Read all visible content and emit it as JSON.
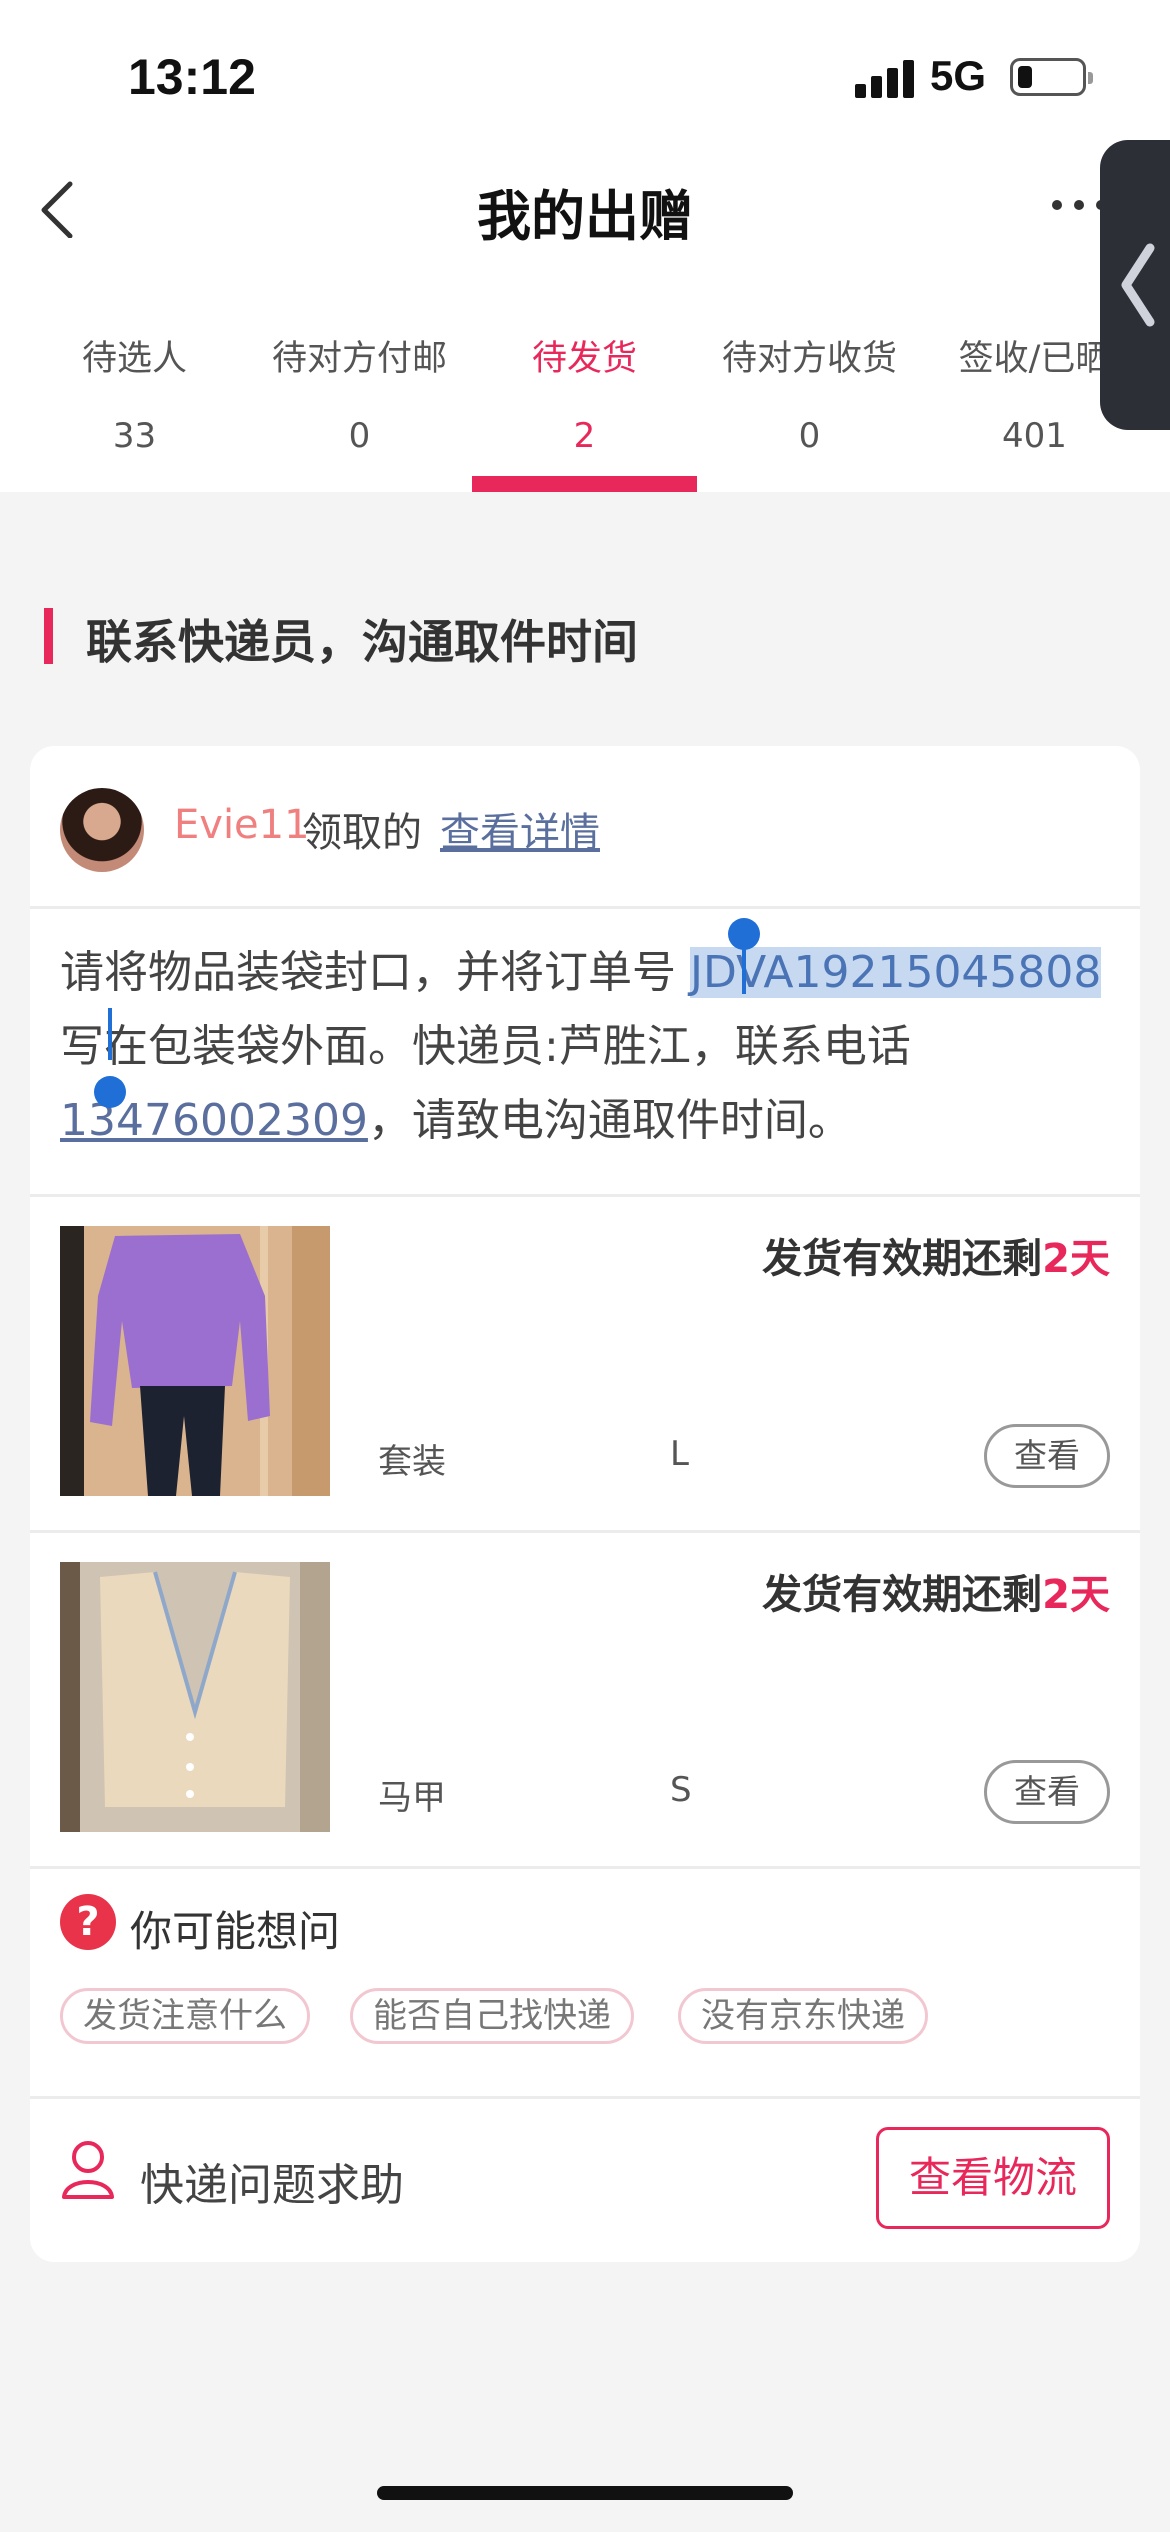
{
  "status_bar": {
    "time": "13:12",
    "network": "5G"
  },
  "header": {
    "title": "我的出赠"
  },
  "tabs": [
    {
      "label": "待选人",
      "count": "33",
      "active": false
    },
    {
      "label": "待对方付邮",
      "count": "0",
      "active": false
    },
    {
      "label": "待发货",
      "count": "2",
      "active": true
    },
    {
      "label": "待对方收货",
      "count": "0",
      "active": false
    },
    {
      "label": "签收/已晒",
      "count": "401",
      "active": false
    }
  ],
  "section": {
    "title": "联系快递员，沟通取件时间"
  },
  "order": {
    "receiver_name": "Evie11",
    "receiver_action": "领取的",
    "details_link": "查看详情",
    "instruction_prefix": "请将物品装袋封口，并将订单号",
    "order_number": "JDVA19215045808",
    "instruction_middle": "写在包装袋外面。快递员:芦胜江，联系电话",
    "phone": "13476002309",
    "instruction_suffix": "，请致电沟通取件时间。"
  },
  "items": [
    {
      "deadline_prefix": "发货有效期还剩",
      "deadline_days": "2天",
      "category": "套装",
      "size": "L",
      "view_label": "查看"
    },
    {
      "deadline_prefix": "发货有效期还剩",
      "deadline_days": "2天",
      "category": "马甲",
      "size": "S",
      "view_label": "查看"
    }
  ],
  "faq": {
    "title": "你可能想问",
    "icon": "question-circle-icon",
    "chips": [
      "发货注意什么",
      "能否自己找快递",
      "没有京东快递"
    ]
  },
  "footer": {
    "help_label": "快递问题求助",
    "logistics_button": "查看物流"
  },
  "colors": {
    "accent": "#e8285a",
    "link": "#5a6f9e",
    "selection": "#c6d9f0"
  }
}
